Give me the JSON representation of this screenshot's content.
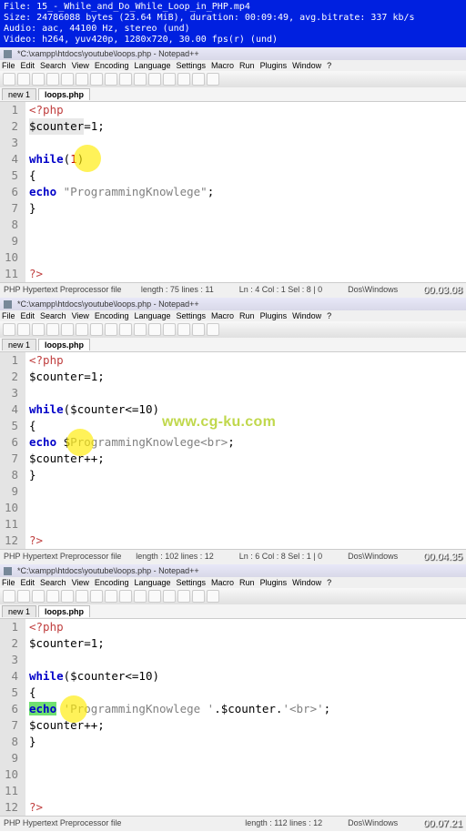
{
  "video_info": {
    "file": "File: 15_-_While_and_Do_While_Loop_in_PHP.mp4",
    "size": "Size: 24786088 bytes (23.64 MiB), duration: 00:09:49, avg.bitrate: 337 kb/s",
    "audio": "Audio: aac, 44100 Hz, stereo (und)",
    "video": "Video: h264, yuv420p, 1280x720, 30.00 fps(r) (und)"
  },
  "menus": [
    "File",
    "Edit",
    "Search",
    "View",
    "Encoding",
    "Language",
    "Settings",
    "Macro",
    "Run",
    "Plugins",
    "Window",
    "?"
  ],
  "titlebar_text": "*C:\\xampp\\htdocs\\youtube\\loops.php - Notepad++",
  "tabs": {
    "inactive": "new 1",
    "active": "loops.php"
  },
  "panes": [
    {
      "lines": [
        "1",
        "2",
        "3",
        "4",
        "5",
        "6",
        "7",
        "8",
        "9",
        "10",
        "11"
      ],
      "code": {
        "l1": "<?php",
        "l2_var": "$counter",
        "l2_rest": "=1;",
        "l4_kw": "while",
        "l4_paren_open": "(",
        "l4_num": "1",
        "l4_paren_close": ")",
        "l5_brace": "{",
        "l6_kw": "echo",
        "l6_str": " \"ProgrammingKnowlege\"",
        "l6_semi": ";",
        "l7_brace": "}",
        "l11": "?>"
      },
      "status": {
        "type": "PHP Hypertext Preprocessor file",
        "length": "length : 75   lines : 11",
        "pos": "Ln : 4   Col : 1   Sel : 8 | 0",
        "enc": "Dos\\Windows"
      },
      "timestamp": "00.03.08"
    },
    {
      "lines": [
        "1",
        "2",
        "3",
        "4",
        "5",
        "6",
        "7",
        "8",
        "9",
        "10",
        "11",
        "12"
      ],
      "code": {
        "l1": "<?php",
        "l2": "$counter=1;",
        "l4_kw": "while",
        "l4_expr": "($counter<=10)",
        "l5_brace": "{",
        "l6_kw": "echo",
        "l6_pre": " $",
        "l6_str": "ProgrammingKnowlege<br>",
        "l6_semi": ";",
        "l7": "$counter++;",
        "l8_brace": "}",
        "l12": "?>"
      },
      "status": {
        "type": "PHP Hypertext Preprocessor file",
        "length": "length : 102   lines : 12",
        "pos": "Ln : 6   Col : 8   Sel : 1 | 0",
        "enc": "Dos\\Windows"
      },
      "timestamp": "00.04.35"
    },
    {
      "lines": [
        "1",
        "2",
        "3",
        "4",
        "5",
        "6",
        "7",
        "8",
        "9",
        "10",
        "11",
        "12"
      ],
      "code": {
        "l1": "<?php",
        "l2": "$counter=1;",
        "l4_kw": "while",
        "l4_expr": "($counter<=10)",
        "l5_brace": "{",
        "l6_kw": "echo",
        "l6_str1": " 'ProgrammingKnowlege '",
        "l6_mid": ".$counter.",
        "l6_str2": "'<br>'",
        "l6_semi": ";",
        "l7": "$counter++;",
        "l8_brace": "}",
        "l12": "?>"
      },
      "status": {
        "type": "PHP Hypertext Preprocessor file",
        "length": "length : 112   lines : 12",
        "pos": "",
        "enc": "Dos\\Windows"
      },
      "timestamp": "00.07.21"
    }
  ],
  "watermark": "www.cg-ku.com"
}
